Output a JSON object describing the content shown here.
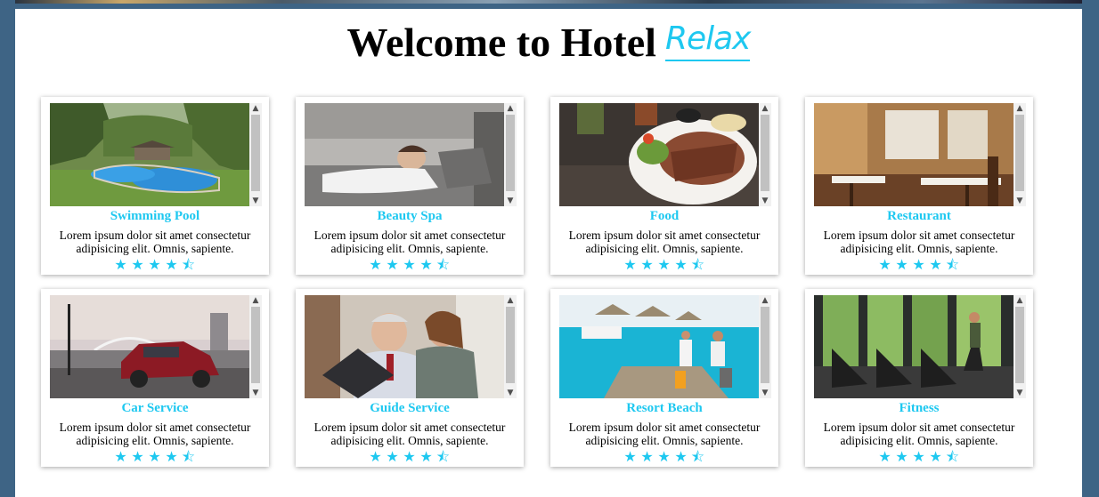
{
  "header": {
    "title_main": "Welcome to Hotel",
    "title_accent": "Relax"
  },
  "colors": {
    "accent": "#1ec8f0",
    "frame": "#3e6485"
  },
  "services": [
    {
      "title": "Swimming Pool",
      "description": "Lorem ipsum dolor sit amet consectetur adipisicing elit. Omnis, sapiente.",
      "rating": 4.5,
      "image": "swimming-pool-photo"
    },
    {
      "title": "Beauty Spa",
      "description": "Lorem ipsum dolor sit amet consectetur adipisicing elit. Omnis, sapiente.",
      "rating": 4.5,
      "image": "beauty-spa-photo"
    },
    {
      "title": "Food",
      "description": "Lorem ipsum dolor sit amet consectetur adipisicing elit. Omnis, sapiente.",
      "rating": 4.5,
      "image": "food-photo"
    },
    {
      "title": "Restaurant",
      "description": "Lorem ipsum dolor sit amet consectetur adipisicing elit. Omnis, sapiente.",
      "rating": 4.5,
      "image": "restaurant-photo"
    },
    {
      "title": "Car Service",
      "description": "Lorem ipsum dolor sit amet consectetur adipisicing elit. Omnis, sapiente.",
      "rating": 4.5,
      "image": "car-service-photo"
    },
    {
      "title": "Guide Service",
      "description": "Lorem ipsum dolor sit amet consectetur adipisicing elit. Omnis, sapiente.",
      "rating": 4.5,
      "image": "guide-service-photo"
    },
    {
      "title": "Resort Beach",
      "description": "Lorem ipsum dolor sit amet consectetur adipisicing elit. Omnis, sapiente.",
      "rating": 4.5,
      "image": "resort-beach-photo"
    },
    {
      "title": "Fitness",
      "description": "Lorem ipsum dolor sit amet consectetur adipisicing elit. Omnis, sapiente.",
      "rating": 4.5,
      "image": "fitness-photo"
    }
  ]
}
